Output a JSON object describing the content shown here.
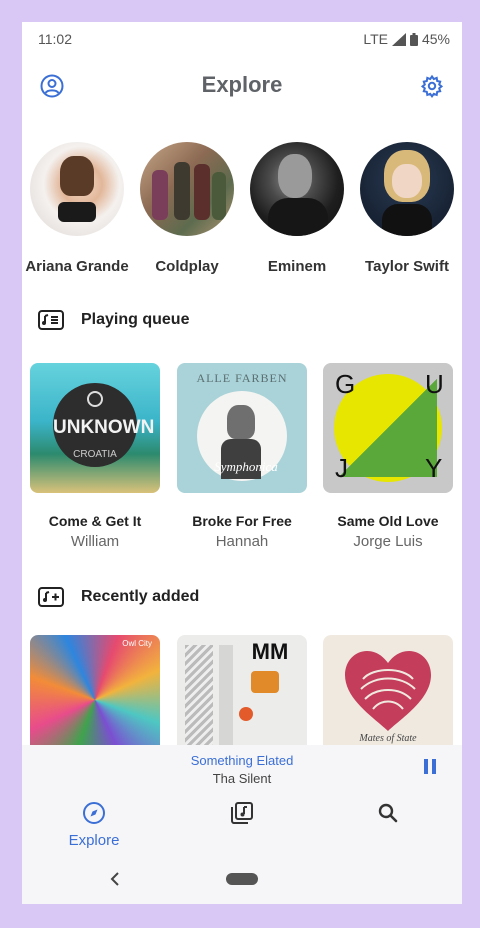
{
  "status": {
    "time": "11:02",
    "network": "LTE",
    "battery": "45%"
  },
  "header": {
    "title": "Explore",
    "account_icon": "account-circle-icon",
    "settings_icon": "gear-icon"
  },
  "artists": [
    {
      "name": "Ariana Grande"
    },
    {
      "name": "Coldplay"
    },
    {
      "name": "Eminem"
    },
    {
      "name": "Taylor Swift"
    }
  ],
  "queue": {
    "title": "Playing queue",
    "icon": "queue-music-icon",
    "albums": [
      {
        "title": "Come & Get It",
        "artist": "William",
        "art_text": "UNKNOWN",
        "art_sub": "CROATIA"
      },
      {
        "title": "Broke For Free",
        "artist": "Hannah",
        "art_text": "ALLE FARBEN",
        "art_sub": "Symphonica"
      },
      {
        "title": "Same Old Love",
        "artist": "Jorge Luis",
        "art_letters": [
          "G",
          "U",
          "J",
          "Y"
        ]
      }
    ]
  },
  "recent": {
    "title": "Recently added",
    "icon": "playlist-add-icon",
    "albums": [
      {
        "art_text": "Owl City"
      },
      {
        "art_text": "MM"
      },
      {
        "art_text": "Mates of State"
      }
    ]
  },
  "player": {
    "title": "Something Elated",
    "artist": "Tha Silent",
    "state": "playing"
  },
  "nav": {
    "explore_label": "Explore"
  },
  "colors": {
    "accent": "#3b6fd6",
    "background": "#d9c7f5"
  }
}
